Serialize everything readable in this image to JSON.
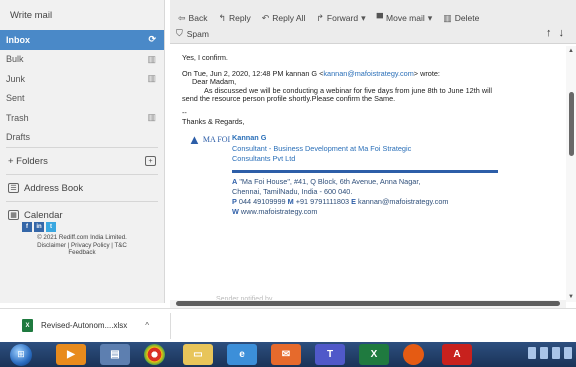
{
  "sidebar": {
    "write_mail": "Write mail",
    "folders": [
      {
        "label": "Inbox",
        "icon": "refresh-icon",
        "active": true
      },
      {
        "label": "Bulk",
        "icon": "trash-icon",
        "active": false
      },
      {
        "label": "Junk",
        "icon": "trash-icon",
        "active": false
      },
      {
        "label": "Sent",
        "icon": "",
        "active": false
      },
      {
        "label": "Trash",
        "icon": "trash-icon",
        "active": false
      },
      {
        "label": "Drafts",
        "icon": "",
        "active": false
      }
    ],
    "folders_section": "+ Folders",
    "address_book": "Address Book",
    "calendar": "Calendar",
    "footer_copyright": "© 2021 Rediff.com India Limited.",
    "footer_links": "Disclaimer | Privacy Policy | T&C",
    "footer_feedback": "Feedback"
  },
  "toolbar": {
    "back": "Back",
    "reply": "Reply",
    "reply_all": "Reply All",
    "forward": "Forward",
    "move_mail": "Move mail",
    "delete": "Delete",
    "spam": "Spam"
  },
  "message": {
    "confirm_line": "Yes, I confirm.",
    "quote_prefix": "On Tue, Jun 2, 2020, 12:48 PM kannan G <",
    "quote_email": "kannan@mafoistrategy.com",
    "quote_suffix": "> wrote:",
    "salutation": "Dear Madam,",
    "body_line1": "As discussed we will be conducting a webinar for five days from june 8th to June 12th will",
    "body_line2": "send the resource person profile shortly.Please confirm the Same.",
    "dashes": "--",
    "regards": "Thanks & Regards,",
    "logo_text": "MA FOI",
    "sig_name": "Kannan G",
    "sig_role": "Consultant - Business Development at  Ma Foi Strategic",
    "sig_company": "Consultants Pvt Ltd",
    "addr_label": "A",
    "addr1": "\"Ma Foi House\", #41, Q Block, 6th Avenue, Anna Nagar,",
    "addr2": "Chennai, TamilNadu, India - 600 040.",
    "phone_label": "P",
    "phone": "044 49109999",
    "mobile_label": "M",
    "mobile": "+91 9791111803",
    "email_label": "E",
    "email": "kannan@mafoistrategy.com",
    "web_label": "W",
    "web": "www.mafoistrategy.com",
    "social": [
      "f",
      "in",
      "t"
    ],
    "faded_text": "Sender notified by"
  },
  "download_bar": {
    "filename": "Revised-Autonom....xlsx",
    "caret": "^"
  },
  "taskbar": {
    "apps": [
      "ie-icon",
      "media-player-icon",
      "explorer-icon",
      "chrome-icon",
      "folder-icon",
      "ie-app-icon",
      "outlook-icon",
      "teams-icon",
      "excel-icon",
      "firefox-icon",
      "acrobat-icon"
    ]
  }
}
